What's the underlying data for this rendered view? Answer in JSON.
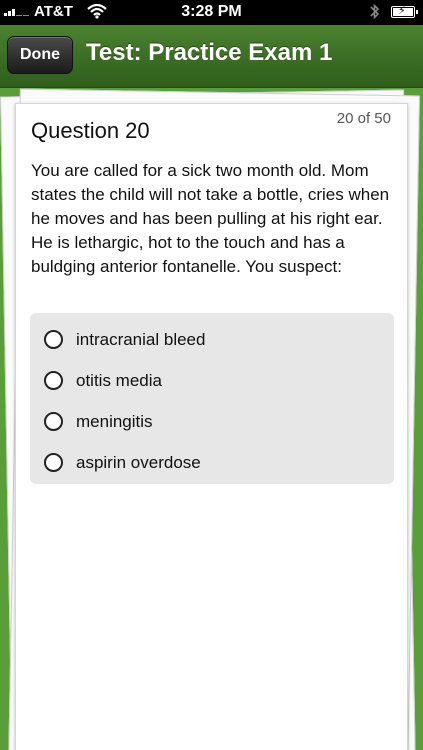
{
  "status_bar": {
    "carrier": "AT&T",
    "time": "3:28 PM",
    "signal_icon": "signal-bars-icon",
    "wifi_icon": "wifi-icon",
    "bluetooth_icon": "bluetooth-icon",
    "battery_icon": "battery-charging-icon"
  },
  "nav": {
    "done_label": "Done",
    "title": "Test: Practice Exam 1"
  },
  "question": {
    "counter": "20 of 50",
    "title": "Question 20",
    "text": "You are called for a sick two month old. Mom states the child will not take a bottle, cries when he moves and has been pulling at his right ear.  He is lethargic, hot to the touch and has a buldging anterior fontanelle.  You suspect:",
    "options": [
      {
        "label": "intracranial bleed"
      },
      {
        "label": "otitis media"
      },
      {
        "label": "meningitis"
      },
      {
        "label": "aspirin overdose"
      }
    ]
  },
  "colors": {
    "nav_green": "#3c6f25",
    "background_green": "#5a9e3a",
    "options_bg": "#e7e7e7"
  }
}
